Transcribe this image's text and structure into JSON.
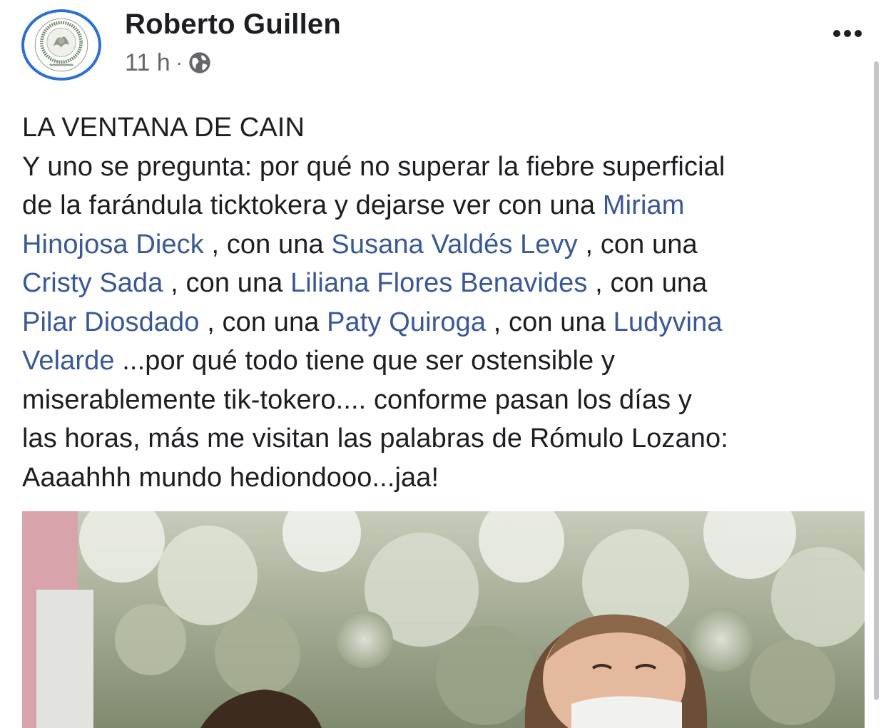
{
  "post": {
    "author": "Roberto Guillen",
    "timestamp": "11 h",
    "separator": "·",
    "privacy_icon": "globe-icon",
    "more_icon": "more-dots-icon"
  },
  "body": {
    "title": "LA VENTANA DE CAIN",
    "t1": "Y uno se pregunta: por qué no superar la fiebre superficial",
    "t2": "de la farándula ticktokera y dejarse ver con una ",
    "m1a": "Miriam",
    "m1b": "Hinojosa Dieck",
    "t3": " , con una ",
    "m2": "Susana Valdés Levy",
    "t4": " , con una",
    "m3": "Cristy Sada",
    "t5": " , con una ",
    "m4": "Liliana Flores Benavides",
    "t6": " , con una",
    "m5": "Pilar Diosdado",
    "t7": " , con una ",
    "m6": "Paty Quiroga",
    "t8": " , con una ",
    "m7a": "Ludyvina",
    "m7b": "Velarde",
    "t9": " ...por qué todo tiene que ser ostensible y",
    "t10": "miserablemente tik-tokero.... conforme pasan los días y",
    "t11": "las horas, más me visitan las palabras de Rómulo Lozano:",
    "t12": "Aaaahhh mundo hediondooo...jaa!"
  },
  "colors": {
    "mention": "#385898",
    "avatar_ring": "#2d6fd6",
    "text": "#1c1e21",
    "meta": "#65676b"
  }
}
